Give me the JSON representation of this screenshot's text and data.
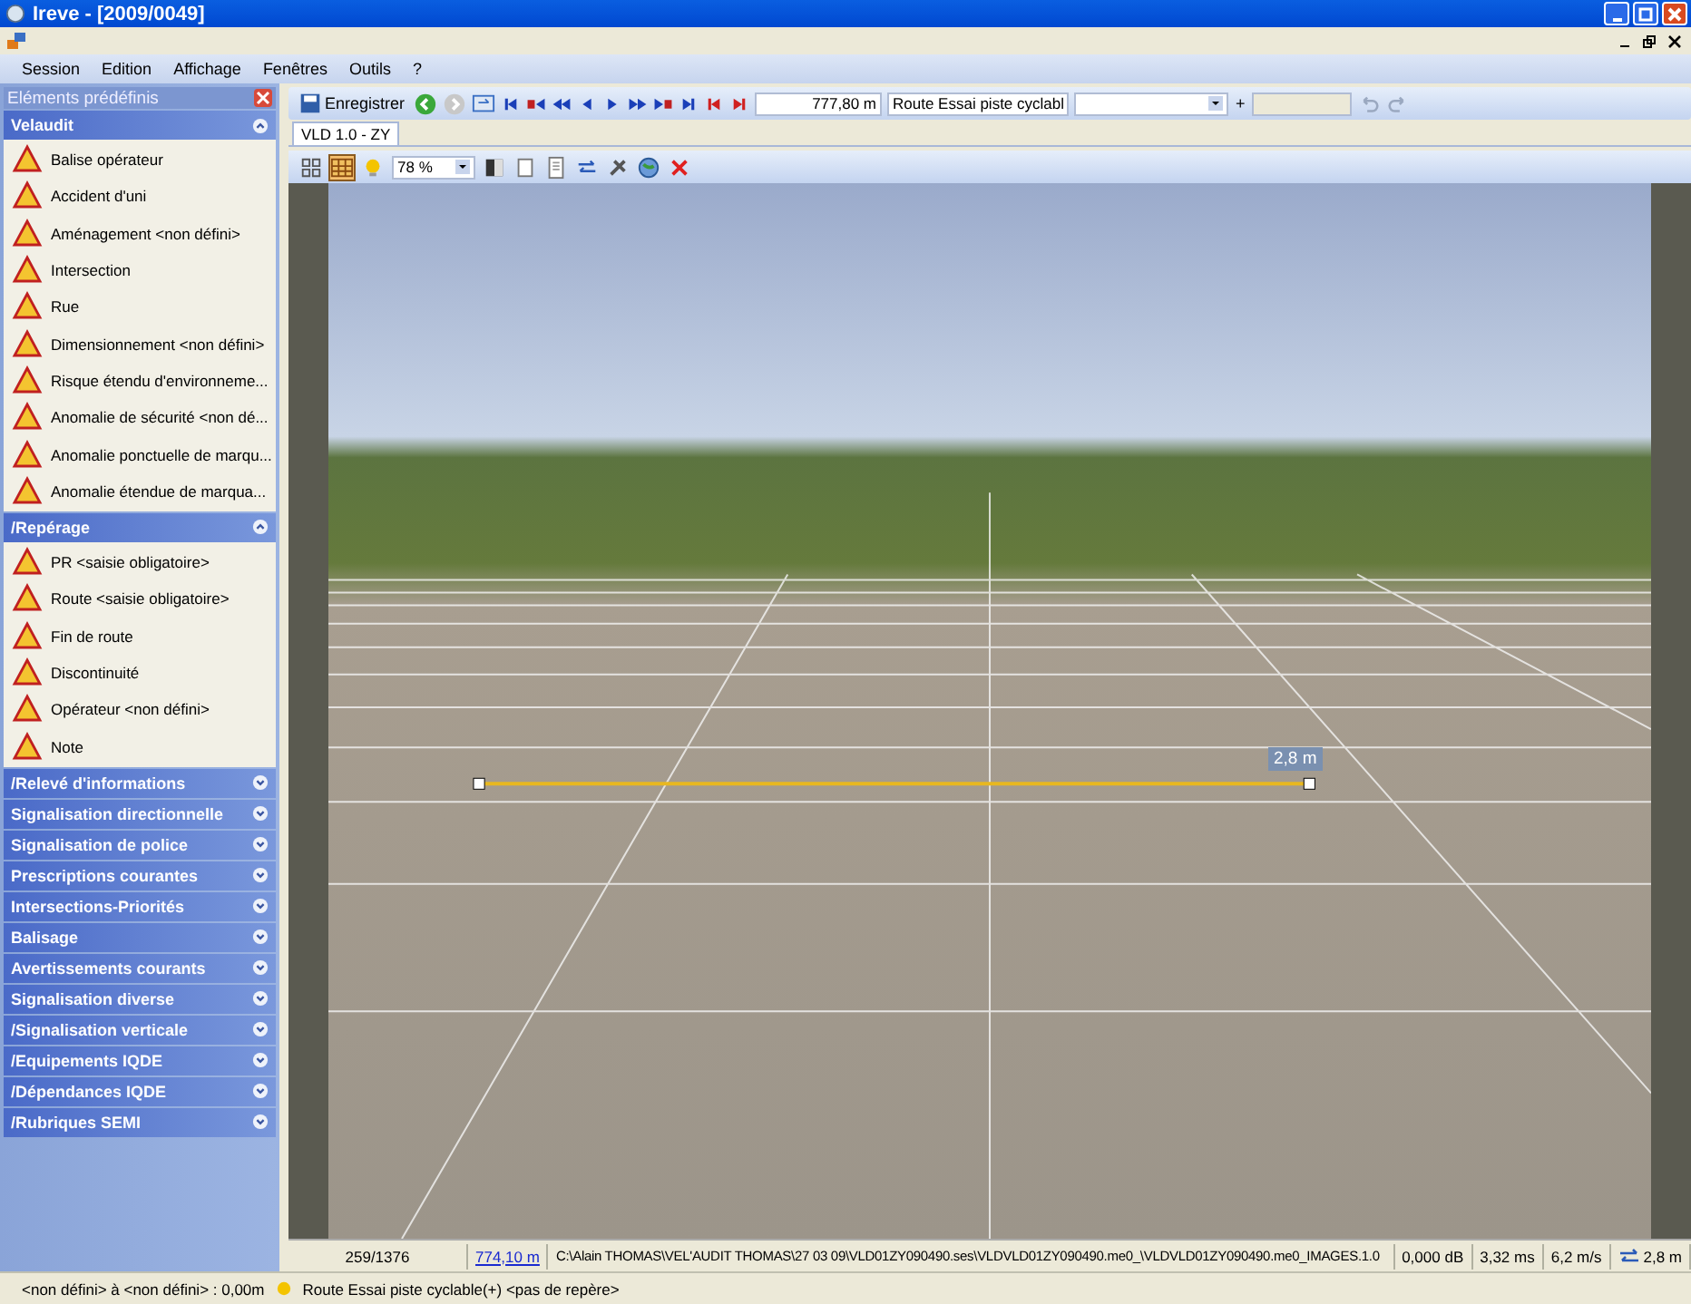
{
  "window": {
    "title": "Ireve - [2009/0049]"
  },
  "menu": [
    "Session",
    "Edition",
    "Affichage",
    "Fenêtres",
    "Outils",
    "?"
  ],
  "panel": {
    "title": "Eléments prédéfinis",
    "sections": [
      {
        "title": "Velaudit",
        "expanded": true,
        "items": [
          "Balise opérateur",
          "Accident d'uni",
          "Aménagement <non défini>",
          "Intersection",
          "Rue",
          "Dimensionnement <non défini>",
          "Risque étendu d'environneme...",
          "Anomalie de sécurité <non dé...",
          "Anomalie ponctuelle de marqu...",
          "Anomalie étendue de marqua..."
        ]
      },
      {
        "title": "/Repérage",
        "expanded": true,
        "items": [
          "PR <saisie obligatoire>",
          "Route <saisie obligatoire>",
          "Fin de route",
          "Discontinuité",
          "Opérateur <non défini>",
          "Note"
        ]
      },
      {
        "title": "/Relevé d'informations",
        "expanded": false
      },
      {
        "title": "Signalisation directionnelle",
        "expanded": false
      },
      {
        "title": "Signalisation de police",
        "expanded": false
      },
      {
        "title": "Prescriptions courantes",
        "expanded": false
      },
      {
        "title": "Intersections-Priorités",
        "expanded": false
      },
      {
        "title": "Balisage",
        "expanded": false
      },
      {
        "title": "Avertissements courants",
        "expanded": false
      },
      {
        "title": "Signalisation diverse",
        "expanded": false
      },
      {
        "title": "/Signalisation verticale",
        "expanded": false
      },
      {
        "title": "/Equipements IQDE",
        "expanded": false
      },
      {
        "title": "/Dépendances IQDE",
        "expanded": false
      },
      {
        "title": "/Rubriques SEMI",
        "expanded": false
      }
    ]
  },
  "toolbar": {
    "save": "Enregistrer",
    "distance": "777,80 m",
    "route": "Route Essai piste cyclabl",
    "add": "+"
  },
  "tabs": [
    {
      "label": "VLD 1.0 - ZY",
      "selected": true
    }
  ],
  "viewer_toolbar": {
    "zoom": "78 %"
  },
  "viewer": {
    "measurement": "2,8 m"
  },
  "status_row": {
    "frame": "259/1376",
    "distance": "774,10 m",
    "path": "C:\\Alain THOMAS\\VEL'AUDIT THOMAS\\27 03 09\\VLD01ZY090490.ses\\VLDVLD01ZY090490.me0_\\VLDVLD01ZY090490.me0_IMAGES.1.0",
    "level": "0,000 dB",
    "time": "3,32 ms",
    "speed": "6,2 m/s",
    "width": "2,8 m"
  },
  "status_bar": {
    "position": "<non défini> à <non défini> : 0,00m",
    "route": "Route Essai piste cyclable(+) <pas de repère>"
  }
}
